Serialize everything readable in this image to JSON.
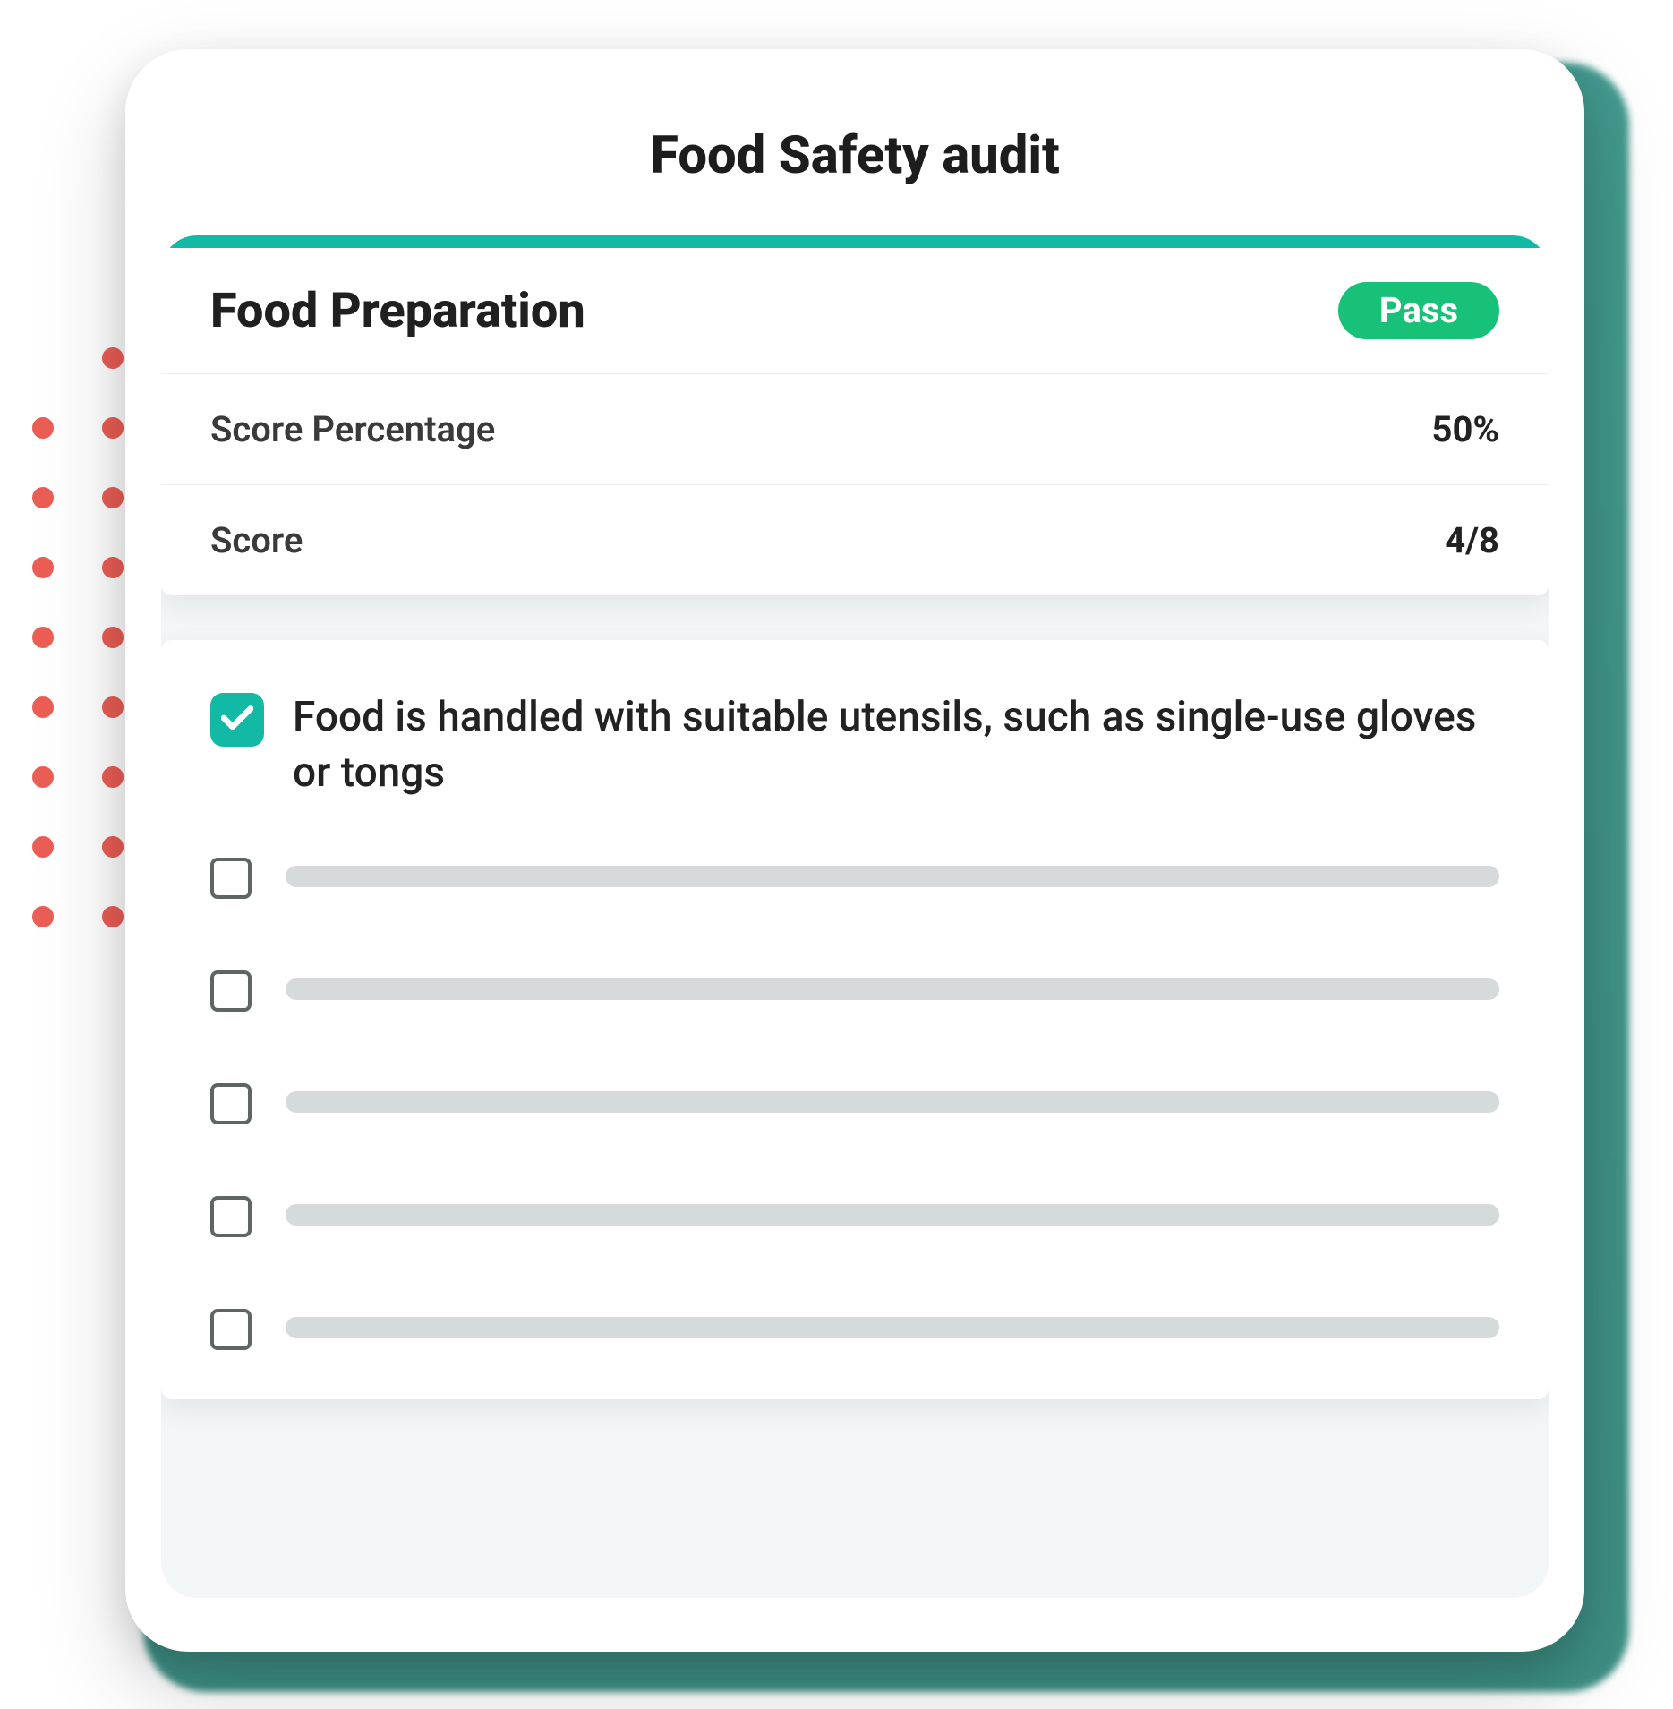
{
  "colors": {
    "accent": "#12B9A4",
    "pass": "#17C177",
    "dot": "#EB5E55",
    "teal_bg": "#2F8F82",
    "placeholder": "#d7dada"
  },
  "audit": {
    "title": "Food Safety audit"
  },
  "section": {
    "title": "Food Preparation",
    "status_label": "Pass",
    "rows": [
      {
        "label": "Score Percentage",
        "value": "50%"
      },
      {
        "label": "Score",
        "value": "4/8"
      }
    ]
  },
  "checklist": {
    "items": [
      {
        "checked": true,
        "text": "Food is handled with suitable utensils, such as single-use gloves or tongs"
      },
      {
        "checked": false,
        "text": ""
      },
      {
        "checked": false,
        "text": ""
      },
      {
        "checked": false,
        "text": ""
      },
      {
        "checked": false,
        "text": ""
      },
      {
        "checked": false,
        "text": ""
      }
    ]
  },
  "placeholder_count": 5
}
